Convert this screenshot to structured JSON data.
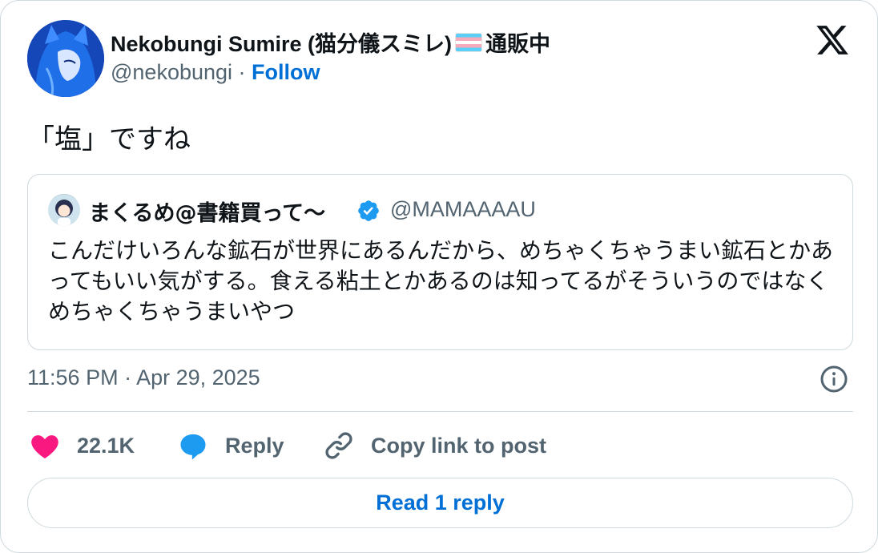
{
  "author": {
    "display_name": "Nekobungi Sumire (猫分儀スミレ)",
    "display_name_suffix": "通販中",
    "handle": "@nekobungi",
    "separator": " · ",
    "follow_label": "Follow",
    "avatar_icon": "avatar-anime-blue-icon",
    "flag_icon": "transgender-flag-icon"
  },
  "brand": {
    "logo_icon": "x-logo-icon"
  },
  "tweet": {
    "text": "「塩」ですね"
  },
  "quoted": {
    "display_name": "まくるめ@書籍買って〜",
    "verified_icon": "verified-badge-icon",
    "handle": "@MAMAAAAU",
    "text": "こんだけいろんな鉱石が世界にあるんだから、めちゃくちゃうまい鉱石とかあってもいい気がする。食える粘土とかあるのは知ってるがそういうのではなくめちゃくちゃうまいやつ"
  },
  "timestamp": "11:56 PM · Apr 29, 2025",
  "actions": {
    "like_count": "22.1K",
    "reply_label": "Reply",
    "copy_label": "Copy link to post"
  },
  "read_replies_label": "Read 1 reply",
  "colors": {
    "link": "#006fd6",
    "muted": "#536471",
    "border": "#cfd9de",
    "like": "#f91880",
    "reply_icon": "#1d9bf0",
    "verified": "#1d9bf0"
  }
}
